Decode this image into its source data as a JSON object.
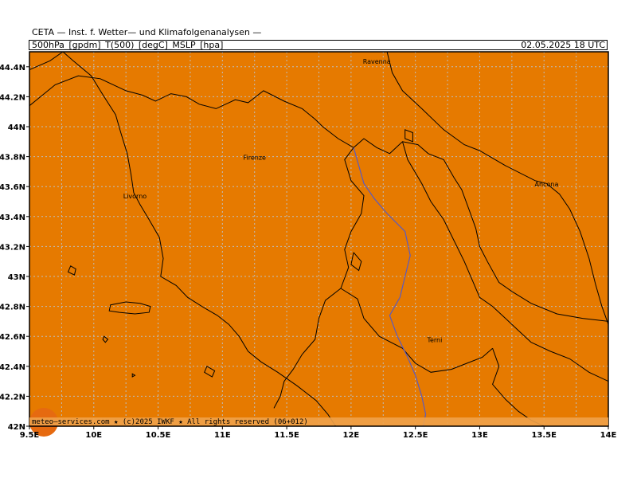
{
  "header": {
    "producer": "CETA — Inst. f. Wetter— und Klimafolgenanalysen —",
    "product": "500hPa_[gpdm]_T(500)_[degC]_MSLP_[hpa]",
    "valid_time": "02.05.2025 18 UTC"
  },
  "map": {
    "fill_color": "#E67A00",
    "warm_spot_color": "#E66A10",
    "grid_color": "#BDBDBD",
    "coast_color": "#000000",
    "river_color": "#5A5AC0",
    "lon_labels": [
      "9.5E",
      "10E",
      "10.5E",
      "11E",
      "11.5E",
      "12E",
      "12.5E",
      "13E",
      "13.5E",
      "14E"
    ],
    "lat_labels": [
      "42N",
      "42.2N",
      "42.4N",
      "42.6N",
      "42.8N",
      "43N",
      "43.2N",
      "43.4N",
      "43.6N",
      "43.8N",
      "44N",
      "44.2N",
      "44.4N"
    ],
    "cities": [
      {
        "name": "Ravenna",
        "lon": 12.2,
        "lat": 44.42
      },
      {
        "name": "Firenze",
        "lon": 11.25,
        "lat": 43.78
      },
      {
        "name": "Livorno",
        "lon": 10.32,
        "lat": 43.52
      },
      {
        "name": "Ancona",
        "lon": 13.52,
        "lat": 43.6
      },
      {
        "name": "Terni",
        "lon": 12.65,
        "lat": 42.56
      }
    ],
    "credit": "meteo—services.com ★ (c)2025 IWKF ★ All rights reserved (06+012)"
  }
}
